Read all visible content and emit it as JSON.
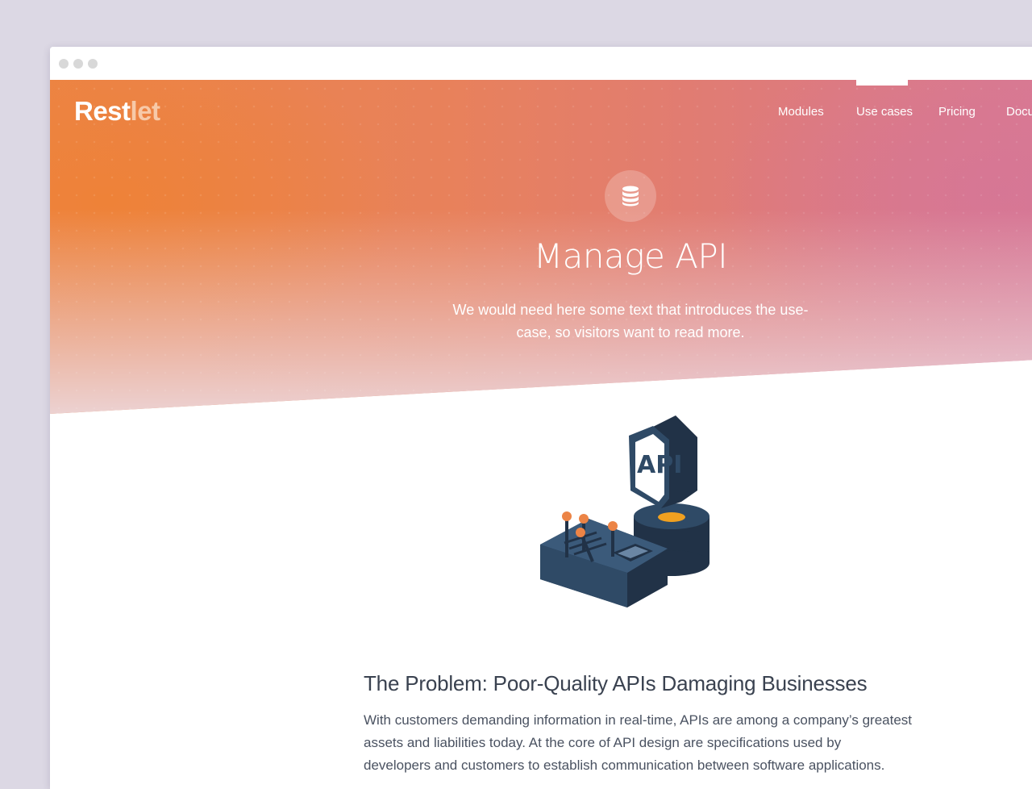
{
  "logo": {
    "brand_strong": "Rest",
    "brand_light": "let"
  },
  "nav": {
    "items": [
      {
        "label": "Modules"
      },
      {
        "label": "Use cases",
        "active": true
      },
      {
        "label": "Pricing"
      },
      {
        "label": "Docu"
      }
    ]
  },
  "hero": {
    "icon": "database-icon",
    "title": "Manage API",
    "subtitle": "We would need here some text that introduces the use-case, so visitors want to read more."
  },
  "illustration": {
    "badge_text": "API"
  },
  "section": {
    "heading": "The Problem: Poor-Quality APIs Damaging Businesses",
    "body": "With customers demanding information in real-time, APIs are among a company’s greatest assets and liabilities today. At the core of API design are specifications used by developers and customers to establish communication between software applications."
  },
  "colors": {
    "gradient_start": "#ec8446",
    "gradient_end": "#d87a93",
    "text_dark": "#3a4250",
    "illustration_navy": "#2f4a66",
    "accent_orange": "#ec8446"
  }
}
